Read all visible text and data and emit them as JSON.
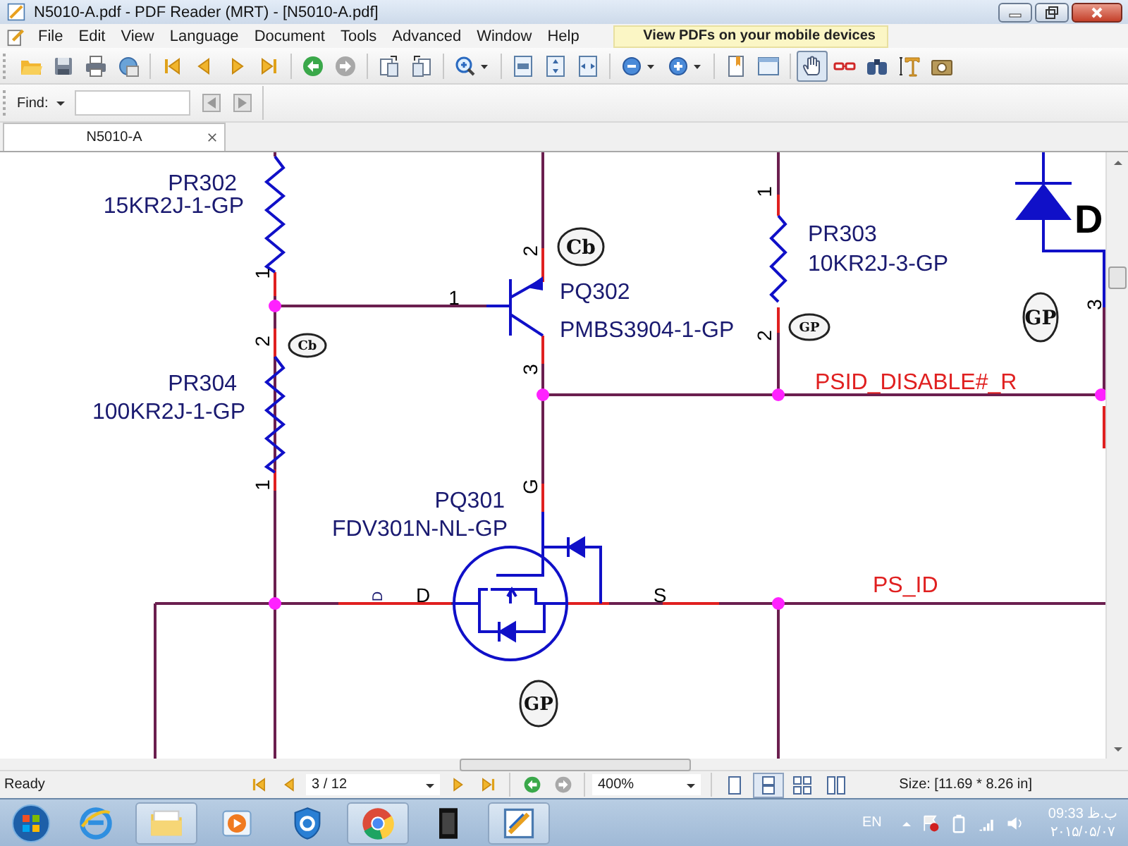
{
  "window": {
    "title": "N5010-A.pdf - PDF Reader (MRT) - [N5010-A.pdf]"
  },
  "menu": [
    "File",
    "Edit",
    "View",
    "Language",
    "Document",
    "Tools",
    "Advanced",
    "Window",
    "Help"
  ],
  "promo": "View PDFs on your mobile devices",
  "tools": [
    {
      "selected": true
    },
    {
      "selected": false
    },
    {
      "selected": false
    },
    {
      "selected": false
    },
    {
      "selected": false
    }
  ],
  "find": {
    "label": "Find:"
  },
  "tabs": [
    {
      "label": "N5010-A",
      "selected": true
    }
  ],
  "schematic": {
    "labels": [
      {
        "text": "PR302",
        "kind": "ref"
      },
      {
        "text": "15KR2J-1-GP",
        "kind": "ref"
      },
      {
        "text": "PR304",
        "kind": "ref"
      },
      {
        "text": "100KR2J-1-GP",
        "kind": "ref"
      },
      {
        "text": "PQ302",
        "kind": "ref"
      },
      {
        "text": "PMBS3904-1-GP",
        "kind": "ref"
      },
      {
        "text": "PR303",
        "kind": "ref"
      },
      {
        "text": "10KR2J-3-GP",
        "kind": "ref"
      },
      {
        "text": "PSID_DISABLE#_R",
        "kind": "net"
      },
      {
        "text": "PQ301",
        "kind": "ref"
      },
      {
        "text": "FDV301N-NL-GP",
        "kind": "ref"
      },
      {
        "text": "PS_ID",
        "kind": "net"
      },
      {
        "text": "D",
        "kind": "heading"
      },
      {
        "text": "1",
        "kind": "pin"
      },
      {
        "text": "2",
        "kind": "pin"
      },
      {
        "text": "1",
        "kind": "pin"
      },
      {
        "text": "1",
        "kind": "pin_label"
      },
      {
        "text": "2",
        "kind": "pin"
      },
      {
        "text": "3",
        "kind": "pin"
      },
      {
        "text": "1",
        "kind": "pin"
      },
      {
        "text": "2",
        "kind": "pin"
      },
      {
        "text": "3",
        "kind": "pin"
      },
      {
        "text": "G",
        "kind": "pin"
      },
      {
        "text": "D",
        "kind": "pin_label"
      },
      {
        "text": "S",
        "kind": "pin_label"
      },
      {
        "text": "D",
        "kind": "small_pin"
      }
    ],
    "stamps": [
      "Cb",
      "Cb",
      "GP",
      "GP",
      "GP"
    ]
  },
  "status": {
    "text": "Ready",
    "page": "3 / 12",
    "zoom": "400%",
    "size": "Size: [11.69 * 8.26 in]"
  },
  "view_modes": [
    {
      "selected": false
    },
    {
      "selected": true
    },
    {
      "selected": false
    },
    {
      "selected": false
    }
  ],
  "taskbar": {
    "language": "EN",
    "time": "09:33 ب.ظ",
    "date": "۲۰۱۵/۰۵/۰۷"
  }
}
